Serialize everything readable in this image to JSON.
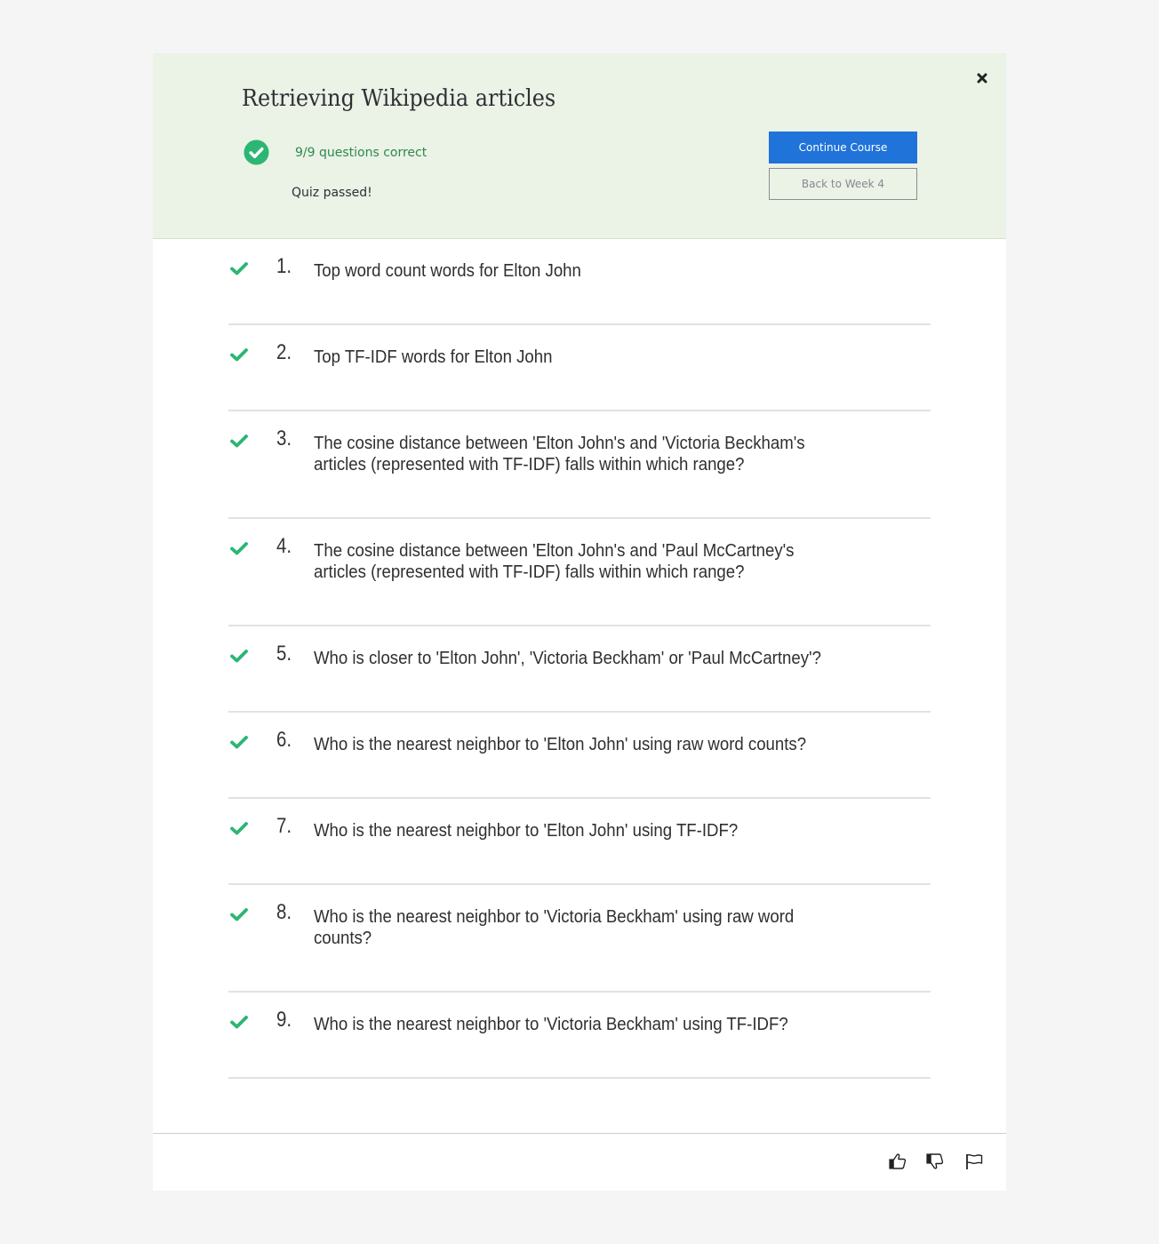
{
  "quiz": {
    "title": "Retrieving Wikipedia articles",
    "score_text": "9/9 questions correct",
    "status_text": "Quiz passed!",
    "colors": {
      "header_bg": "#ebf2e6",
      "success_green": "#2bb673",
      "score_text_green": "#2b8a4e",
      "primary_blue": "#2073d9"
    }
  },
  "buttons": {
    "continue_label": "Continue Course",
    "back_label": "Back to Week 4",
    "close_icon": "close-icon"
  },
  "questions": [
    {
      "number": "1.",
      "text": "Top word count words for Elton John",
      "status": "correct"
    },
    {
      "number": "2.",
      "text": "Top TF-IDF words for Elton John",
      "status": "correct"
    },
    {
      "number": "3.",
      "text": "The cosine distance between 'Elton John's and 'Victoria Beckham's articles (represented with TF-IDF) falls within which range?",
      "status": "correct"
    },
    {
      "number": "4.",
      "text": "The cosine distance between 'Elton John's and 'Paul McCartney's articles (represented with TF-IDF) falls within which range?",
      "status": "correct"
    },
    {
      "number": "5.",
      "text": "Who is closer to 'Elton John', 'Victoria Beckham' or 'Paul McCartney'?",
      "status": "correct"
    },
    {
      "number": "6.",
      "text": "Who is the nearest neighbor to 'Elton John' using raw word counts?",
      "status": "correct"
    },
    {
      "number": "7.",
      "text": "Who is the nearest neighbor to 'Elton John' using TF-IDF?",
      "status": "correct"
    },
    {
      "number": "8.",
      "text": "Who is the nearest neighbor to 'Victoria Beckham' using raw word counts?",
      "status": "correct"
    },
    {
      "number": "9.",
      "text": "Who is the nearest neighbor to 'Victoria Beckham' using TF-IDF?",
      "status": "correct"
    }
  ],
  "footer": {
    "icons": [
      "thumbs-up-icon",
      "thumbs-down-icon",
      "flag-icon"
    ]
  }
}
